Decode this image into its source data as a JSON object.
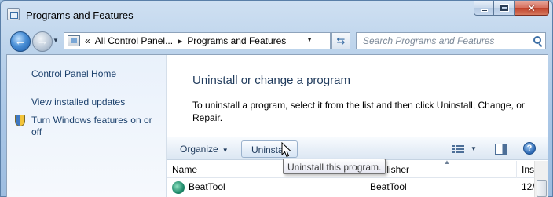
{
  "window": {
    "title": "Programs and Features",
    "icon": "control-panel-icon"
  },
  "navigation": {
    "back_icon": "back-arrow-icon",
    "forward_icon": "forward-arrow-icon",
    "address": {
      "overflow": "«",
      "segments": [
        "All Control Panel...",
        "Programs and Features"
      ]
    },
    "search_placeholder": "Search Programs and Features"
  },
  "sidebar": {
    "links": [
      {
        "label": "Control Panel Home"
      },
      {
        "label": "View installed updates"
      },
      {
        "label": "Turn Windows features on or off",
        "icon": "shield-icon"
      }
    ]
  },
  "main": {
    "heading": "Uninstall or change a program",
    "description": "To uninstall a program, select it from the list and then click Uninstall, Change, or Repair."
  },
  "toolbar": {
    "organize_label": "Organize",
    "uninstall_label": "Uninstall",
    "tooltip": "Uninstall this program."
  },
  "table": {
    "columns": [
      "Name",
      "Publisher",
      "Ins"
    ],
    "rows": [
      {
        "name": "BeatTool",
        "publisher": "BeatTool",
        "installed": "12/"
      }
    ]
  }
}
